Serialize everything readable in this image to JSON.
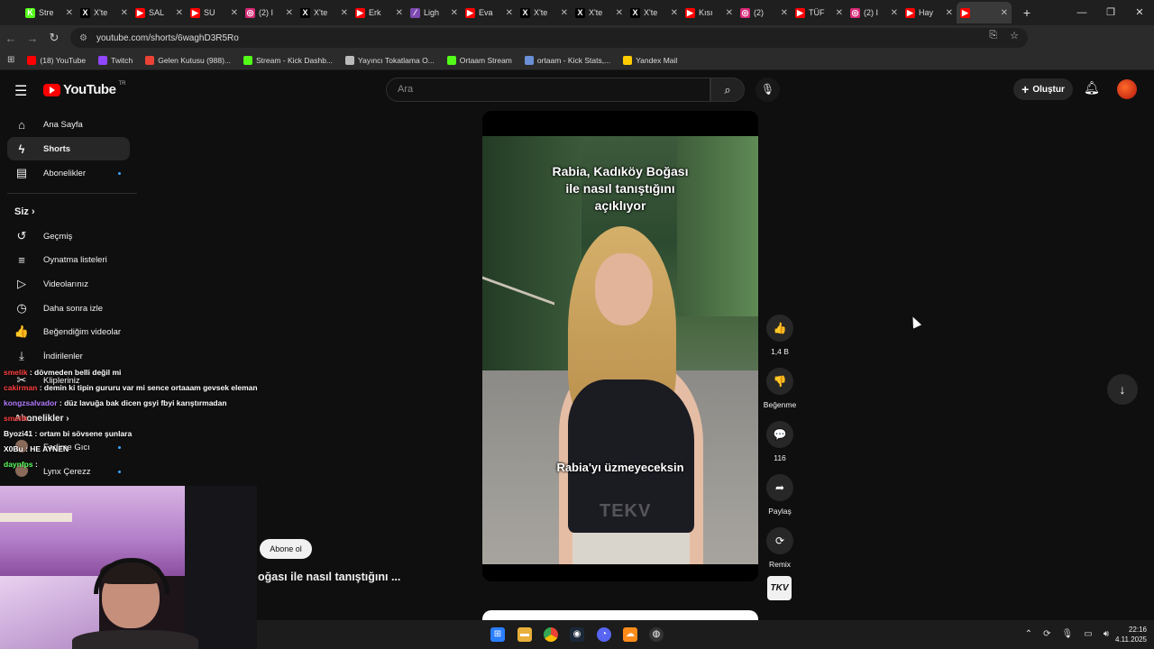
{
  "tabs": [
    {
      "title": "Stre",
      "color": "#53fc18",
      "glyph": "K"
    },
    {
      "title": "X'te",
      "color": "#000000",
      "glyph": "X"
    },
    {
      "title": "SAL",
      "color": "#ff0000",
      "glyph": "▶"
    },
    {
      "title": "SU",
      "color": "#ff0000",
      "glyph": "▶"
    },
    {
      "title": "(2) I",
      "color": "#d62976",
      "glyph": "◎"
    },
    {
      "title": "X'te",
      "color": "#000000",
      "glyph": "X"
    },
    {
      "title": "Erk",
      "color": "#ff0000",
      "glyph": "▶"
    },
    {
      "title": "Ligh",
      "color": "#7d4ab0",
      "glyph": "⁄"
    },
    {
      "title": "Eva",
      "color": "#ff0000",
      "glyph": "▶"
    },
    {
      "title": "X'te",
      "color": "#000000",
      "glyph": "X"
    },
    {
      "title": "X'te",
      "color": "#000000",
      "glyph": "X"
    },
    {
      "title": "X'te",
      "color": "#000000",
      "glyph": "X"
    },
    {
      "title": "Kısı",
      "color": "#ff0000",
      "glyph": "▶"
    },
    {
      "title": "(2)",
      "color": "#d62976",
      "glyph": "◎"
    },
    {
      "title": "TÜF",
      "color": "#ff0000",
      "glyph": "▶"
    },
    {
      "title": "(2) I",
      "color": "#d62976",
      "glyph": "◎"
    },
    {
      "title": "Hay",
      "color": "#ff0000",
      "glyph": "▶"
    },
    {
      "title": "",
      "color": "#ff0000",
      "glyph": "▶"
    }
  ],
  "address": {
    "url": "youtube.com/shorts/6waghD3R5Ro"
  },
  "bookmarks": [
    {
      "label": "(18) YouTube",
      "color": "#ff0000"
    },
    {
      "label": "Twitch",
      "color": "#9146ff"
    },
    {
      "label": "Gelen Kutusu (988)...",
      "color": "#ea4335"
    },
    {
      "label": "Stream - Kick Dashb...",
      "color": "#53fc18"
    },
    {
      "label": "Yayıncı Tokatlama O...",
      "color": "#bbbbbb"
    },
    {
      "label": "Ortaam Stream",
      "color": "#53fc18"
    },
    {
      "label": "ortaam - Kick Stats,...",
      "color": "#6a8fd6"
    },
    {
      "label": "Yandex Mail",
      "color": "#ffcc00"
    }
  ],
  "youtube": {
    "logo": "YouTube",
    "region": "TR",
    "search_placeholder": "Ara",
    "create_label": "Oluştur"
  },
  "sidebar": {
    "items": [
      {
        "label": "Ana Sayfa",
        "icon": "home-icon",
        "glyph": "⌂"
      },
      {
        "label": "Shorts",
        "icon": "shorts-icon",
        "glyph": "ϟ"
      },
      {
        "label": "Abonelikler",
        "icon": "subscriptions-icon",
        "glyph": "▤"
      }
    ],
    "section_title": "Siz",
    "you_items": [
      {
        "label": "Geçmiş",
        "icon": "history-icon",
        "glyph": "↺"
      },
      {
        "label": "Oynatma listeleri",
        "icon": "playlists-icon",
        "glyph": "≡"
      },
      {
        "label": "Videolarınız",
        "icon": "your-videos-icon",
        "glyph": "▷"
      },
      {
        "label": "Daha sonra izle",
        "icon": "watch-later-icon",
        "glyph": "◷"
      },
      {
        "label": "Beğendiğim videolar",
        "icon": "liked-icon",
        "glyph": "👍"
      },
      {
        "label": "İndirilenler",
        "icon": "downloads-icon",
        "glyph": "⤓"
      },
      {
        "label": "Klipleriniz",
        "icon": "clips-icon",
        "glyph": "✂"
      }
    ],
    "subs_title": "Abonelikler",
    "subs": [
      {
        "label": "Fadime Gıcı"
      },
      {
        "label": "Lynx Çerezz"
      }
    ]
  },
  "chat": [
    {
      "user": "smelik",
      "color": "#ff4040",
      "text": "dövmeden belli değil mi"
    },
    {
      "user": "cakirman",
      "color": "#ff4040",
      "text": "demin ki tipin gururu var mi sence ortaaam gevsek eleman"
    },
    {
      "user": "kongzsalvador",
      "color": "#b47cff",
      "text": "düz lavuğa bak dicen gsyi fbyi karıştırmadan"
    },
    {
      "user": "smelik",
      "color": "#ff4040",
      "text": ""
    },
    {
      "user": "Byozi41",
      "color": "#ffffff",
      "text": "ortam bi sövsene şunlara"
    },
    {
      "user": "X0Bu",
      "color": "#ffffff",
      "text": "HE AYNEN"
    },
    {
      "user": "daynfps",
      "color": "#5cff5c",
      "text": ""
    }
  ],
  "short": {
    "caption_top": "Rabia, Kadıköy Boğası\nile nasıl tanıştığını\naçıklıyor",
    "caption_mid": "Rabia'yı üzmeyeceksin",
    "watermark": "TEKV",
    "progress": 0.42,
    "title": "oğası ile nasıl tanıştığını ...",
    "subscribe_label": "Abone ol",
    "channel_logo": "TKV"
  },
  "actions": [
    {
      "label": "1,4 B",
      "icon": "like-icon",
      "glyph": "👍"
    },
    {
      "label": "Beğenme",
      "icon": "dislike-icon",
      "glyph": "👎"
    },
    {
      "label": "116",
      "icon": "comments-icon",
      "glyph": "💬"
    },
    {
      "label": "Paylaş",
      "icon": "share-icon",
      "glyph": "➦"
    },
    {
      "label": "Remix",
      "icon": "remix-icon",
      "glyph": "⟳"
    }
  ],
  "clock": {
    "time": "22:16",
    "date": "4.11.2025"
  }
}
